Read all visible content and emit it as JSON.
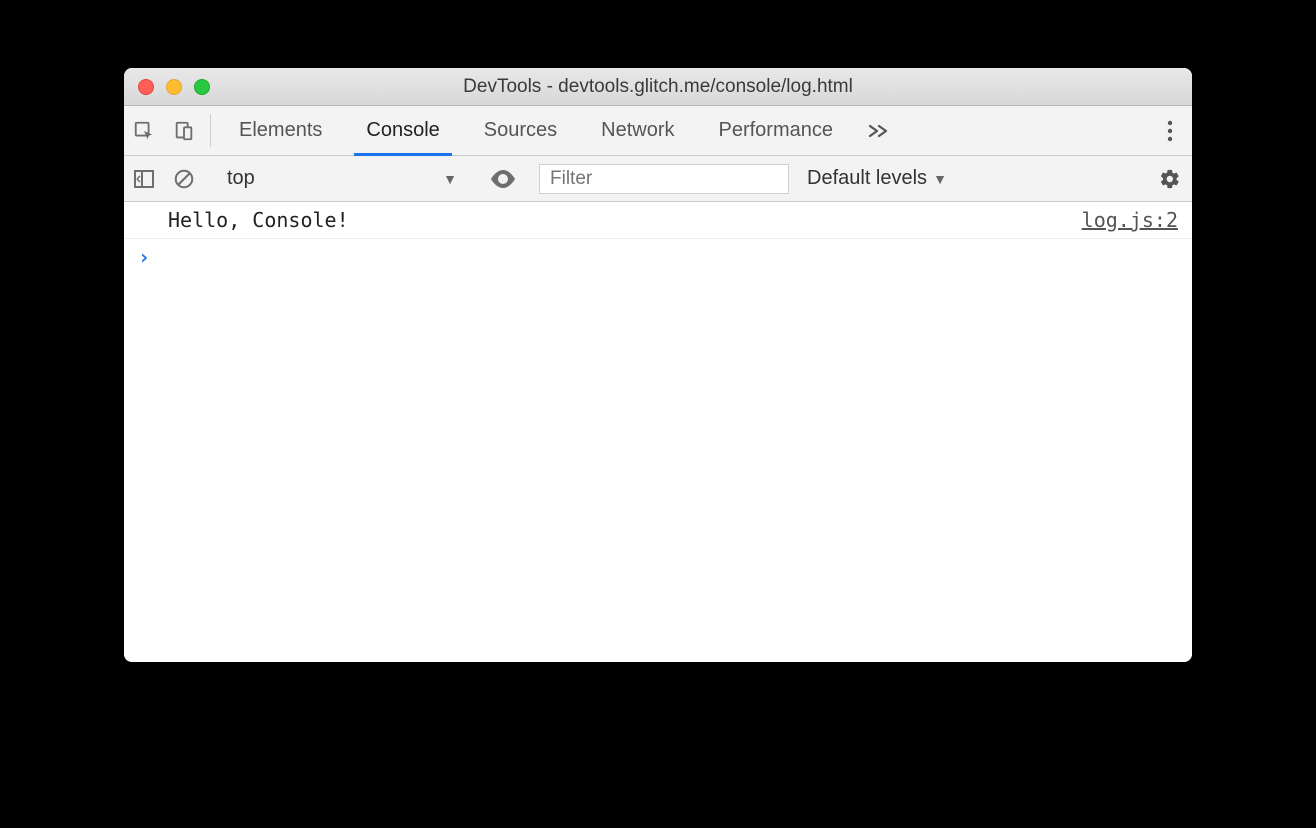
{
  "window": {
    "title": "DevTools - devtools.glitch.me/console/log.html"
  },
  "tabs": {
    "elements": "Elements",
    "console": "Console",
    "sources": "Sources",
    "network": "Network",
    "performance": "Performance"
  },
  "toolbar": {
    "context": "top",
    "filter_placeholder": "Filter",
    "levels": "Default levels"
  },
  "console": {
    "log_message": "Hello, Console!",
    "log_source": "log.js:2"
  }
}
